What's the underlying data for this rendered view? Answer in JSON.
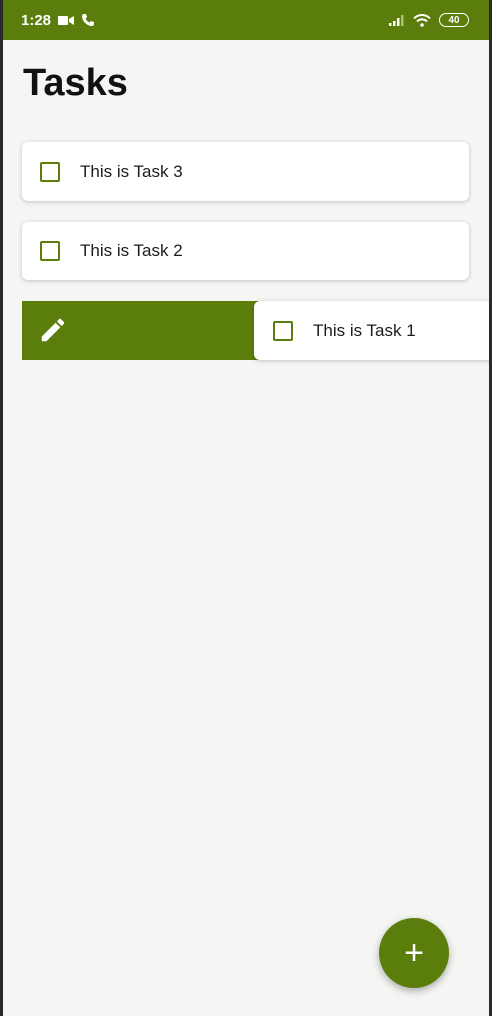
{
  "status_bar": {
    "time": "1:28",
    "battery": "40"
  },
  "page": {
    "title": "Tasks"
  },
  "tasks": [
    {
      "label": "This is Task 3",
      "checked": false
    },
    {
      "label": "This is Task 2",
      "checked": false
    },
    {
      "label": "This is Task 1",
      "checked": false,
      "swiped": true
    }
  ],
  "swipe_action": {
    "icon": "edit-icon"
  },
  "fab": {
    "icon": "plus-icon",
    "label": "+"
  },
  "colors": {
    "accent": "#5b7d0c",
    "background": "#f5f5f3",
    "card": "#ffffff"
  }
}
